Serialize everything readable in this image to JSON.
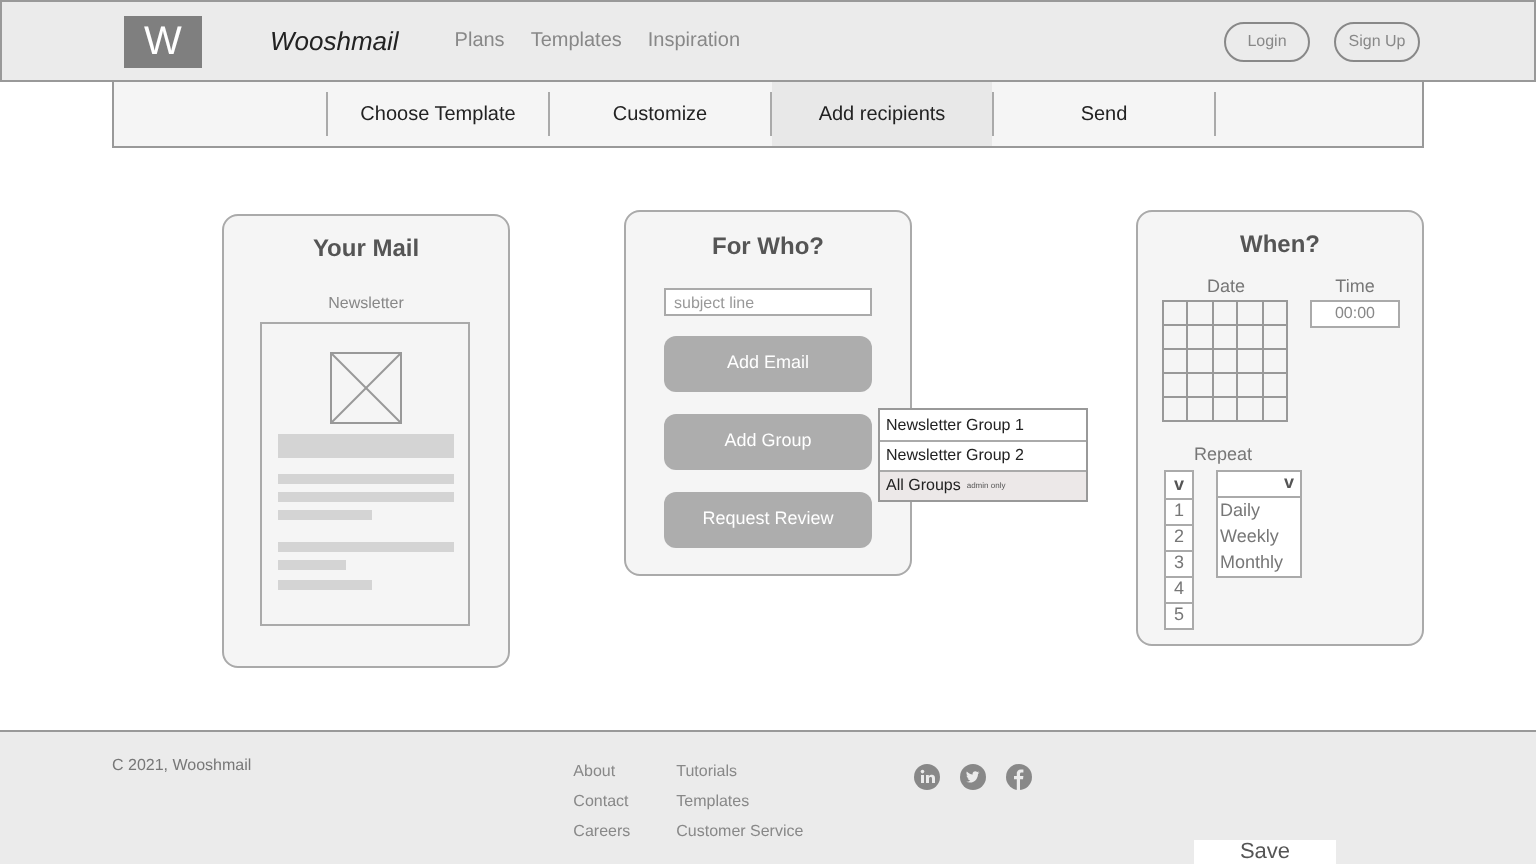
{
  "header": {
    "logo": "W",
    "brand": "Wooshmail",
    "nav": [
      "Plans",
      "Templates",
      "Inspiration"
    ],
    "buttons": [
      "Login",
      "Sign Up"
    ]
  },
  "steps": [
    {
      "label": "Choose Template",
      "selected": false
    },
    {
      "label": "Customize",
      "selected": false
    },
    {
      "label": "Add recipients",
      "selected": true
    },
    {
      "label": "Send",
      "selected": false
    }
  ],
  "your_mail": {
    "title": "Your Mail",
    "template_label": "Newsletter"
  },
  "for_who": {
    "title": "For Who?",
    "subject_placeholder": "subject line",
    "buttons": [
      "Add Email",
      "Add Group",
      "Request Review"
    ],
    "group_menu": [
      {
        "label": "Newsletter Group 1",
        "selected": false
      },
      {
        "label": "Newsletter Group 2",
        "selected": false
      },
      {
        "label": "All Groups",
        "note": "admin only",
        "selected": true
      }
    ]
  },
  "when": {
    "title": "When?",
    "date_label": "Date",
    "time_label": "Time",
    "time_value": "00:00",
    "repeat_label": "Repeat",
    "count_dropdown": {
      "caret": "v",
      "options": [
        "1",
        "2",
        "3",
        "4",
        "5"
      ]
    },
    "frequency_dropdown": {
      "caret": "v",
      "options": [
        "Daily",
        "Weekly",
        "Monthly"
      ]
    }
  },
  "footer": {
    "copyright": "C 2021, Wooshmail",
    "links_1": [
      "About",
      "Contact",
      "Careers"
    ],
    "links_2": [
      "Tutorials",
      "Templates",
      "Customer Service"
    ]
  },
  "save_button": "Save"
}
